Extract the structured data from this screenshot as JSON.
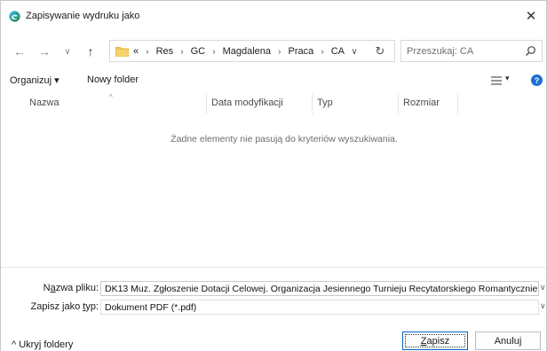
{
  "window": {
    "title": "Zapisywanie wydruku jako",
    "close_glyph": "✕"
  },
  "nav": {
    "back_glyph": "←",
    "forward_glyph": "→",
    "recent_glyph": "∨",
    "up_glyph": "↑",
    "overflow": "«",
    "breadcrumbs": [
      "Res",
      "GC",
      "Magdalena",
      "Praca",
      "CA"
    ],
    "address_dropdown_glyph": "∨",
    "refresh_glyph": "↻",
    "search_placeholder": "Przeszukaj: CA"
  },
  "toolbar": {
    "organize_label": "Organizuj ▾",
    "new_folder_label": "Nowy folder",
    "view_dropdown_glyph": "▾",
    "help_glyph": "?"
  },
  "columns": {
    "name": "Nazwa",
    "modified": "Data modyfikacji",
    "type": "Typ",
    "size": "Rozmiar",
    "sort_glyph": "^"
  },
  "file_list": {
    "empty_message": "Żadne elementy nie pasują do kryteriów wyszukiwania."
  },
  "form": {
    "filename_label_pre": "N",
    "filename_label_underline": "a",
    "filename_label_post": "zwa pliku:",
    "filename_value": "DK13 Muz. Zgłoszenie Dotacji Celowej. Organizacja Jesiennego Turnieju Recytatorskiego Romantycznie",
    "filetype_label_pre": "Zapisz jako ",
    "filetype_label_underline": "t",
    "filetype_label_post": "yp:",
    "filetype_value": "Dokument PDF (*.pdf)",
    "dropdown_glyph": "∨"
  },
  "footer": {
    "hide_folders_label": "^  Ukryj foldery",
    "save_label_underline": "Z",
    "save_label_rest": "apisz",
    "cancel_label": "Anuluj"
  },
  "colors": {
    "accent": "#0067c0",
    "folder": "#f2c64b",
    "help": "#1d6fd3"
  }
}
